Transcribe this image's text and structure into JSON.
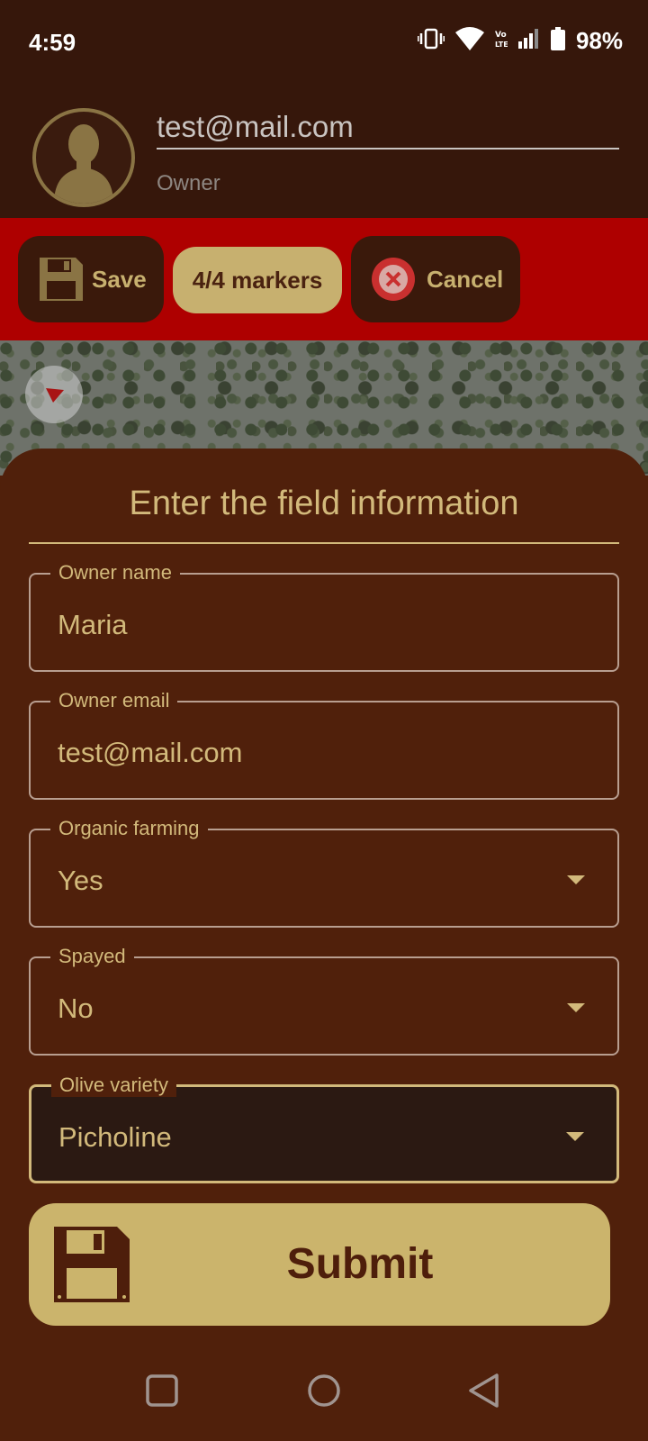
{
  "status_bar": {
    "time": "4:59",
    "battery": "98%",
    "icons": [
      "vibrate-icon",
      "wifi-icon",
      "volte-icon",
      "signal-icon",
      "battery-icon"
    ]
  },
  "header": {
    "email": "test@mail.com",
    "role": "Owner"
  },
  "toolbar": {
    "save_label": "Save",
    "markers_label": "4/4 markers",
    "cancel_label": "Cancel"
  },
  "form": {
    "title": "Enter the field information",
    "fields": [
      {
        "label": "Owner name",
        "value": "Maria"
      },
      {
        "label": "Owner email",
        "value": "test@mail.com"
      },
      {
        "label": "Organic farming",
        "value": "Yes"
      },
      {
        "label": "Spayed",
        "value": "No"
      },
      {
        "label": "Olive variety",
        "value": "Picholine"
      }
    ],
    "submit_label": "Submit"
  },
  "colors": {
    "header_bg": "#36170b",
    "toolbar_bg": "#ae0000",
    "sheet_bg": "#50200b",
    "accent": "#d2b97b",
    "submit_bg": "#cbb46c"
  }
}
